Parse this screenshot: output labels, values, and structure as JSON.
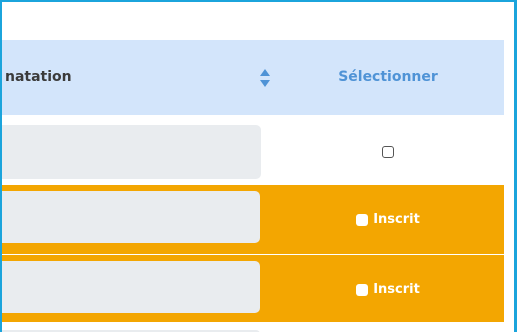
{
  "header": {
    "column_title": "natation",
    "select_label": "Sélectionner",
    "sort_icon": "sort-up-down-icon",
    "sort_color": "#4f93d6"
  },
  "rows": [
    {
      "style": "white",
      "checked": false,
      "badge": ""
    },
    {
      "style": "orange",
      "checked": false,
      "badge": "Inscrit"
    },
    {
      "style": "orange",
      "checked": false,
      "badge": "Inscrit"
    }
  ],
  "colors": {
    "frame_border": "#1ba4dc",
    "header_bg": "#d3e5fb",
    "registered_row_bg": "#f3a601",
    "input_bg": "#e9ecef"
  }
}
